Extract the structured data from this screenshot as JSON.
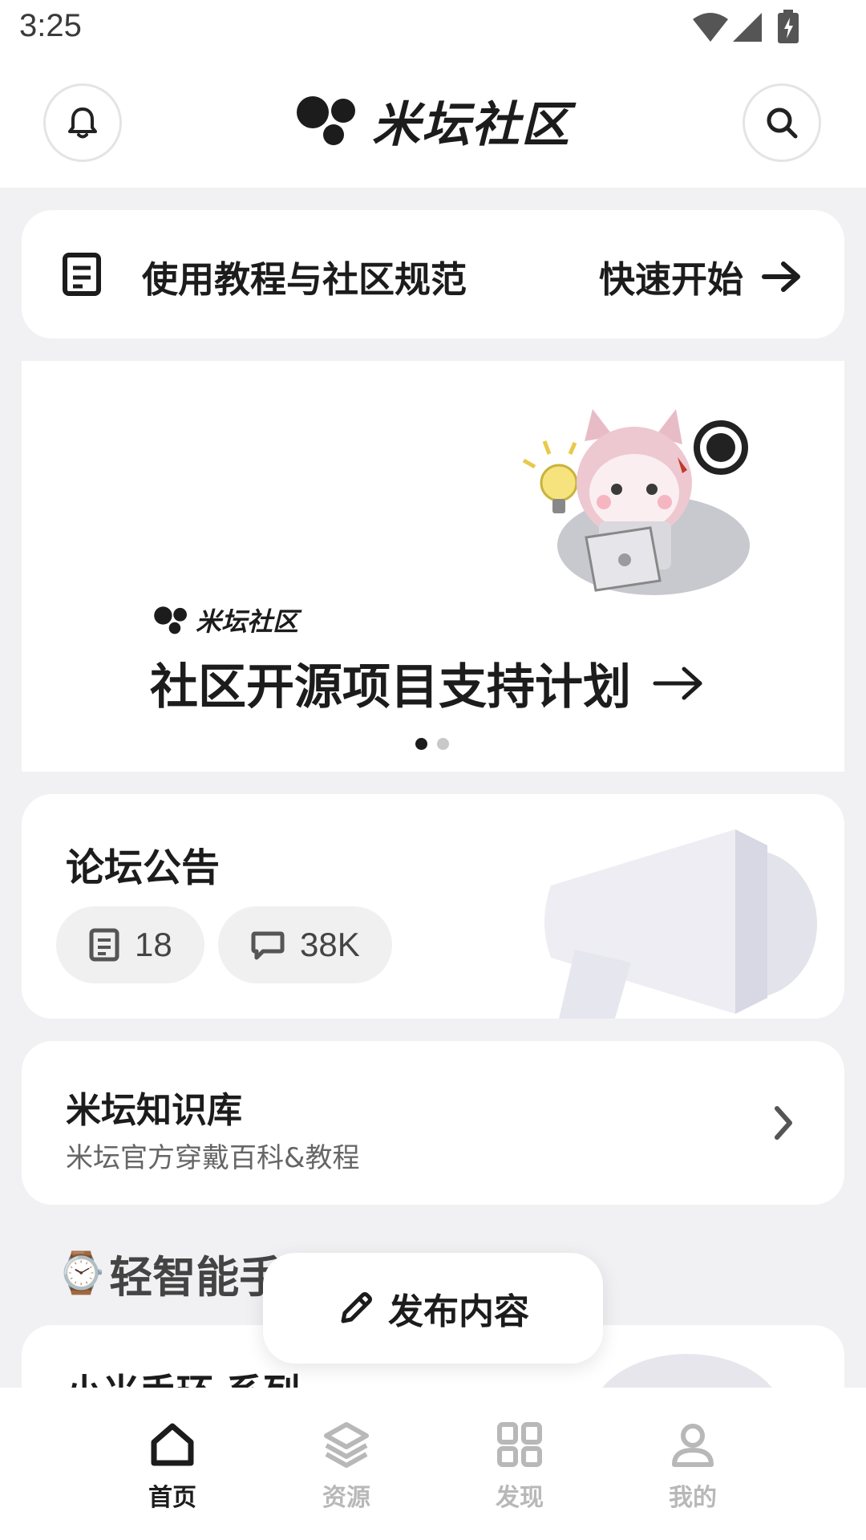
{
  "status_bar": {
    "time": "3:25"
  },
  "header": {
    "brand_text": "米坛社区",
    "notification_icon": "bell-icon",
    "search_icon": "search-icon"
  },
  "guide_card": {
    "title": "使用教程与社区规范",
    "action_label": "快速开始",
    "icon": "document-icon",
    "action_icon": "arrow-right-icon"
  },
  "banner": {
    "logo_text": "米坛社区",
    "title": "社区开源项目支持计划",
    "page_count": 2,
    "active_page": 1,
    "illustration": "cat-girl-laptop-github-illustration"
  },
  "notice_card": {
    "title": "论坛公告",
    "posts_count": "18",
    "comments_count": "38K",
    "posts_icon": "document-icon",
    "comments_icon": "comment-icon",
    "illustration": "megaphone-illustration"
  },
  "knowledge_card": {
    "title": "米坛知识库",
    "subtitle": "米坛官方穿戴百科&教程",
    "chevron_icon": "chevron-right-icon"
  },
  "section": {
    "emoji": "⌚",
    "heading": "轻智能手环 & 手表"
  },
  "partial_card": {
    "title": "小米手环 系列"
  },
  "publish_button": {
    "label": "发布内容",
    "icon": "pencil-icon"
  },
  "bottom_nav": {
    "items": [
      {
        "label": "首页",
        "icon": "home-icon",
        "active": true
      },
      {
        "label": "资源",
        "icon": "layers-icon",
        "active": false
      },
      {
        "label": "发现",
        "icon": "grid-icon",
        "active": false
      },
      {
        "label": "我的",
        "icon": "user-icon",
        "active": false
      }
    ]
  },
  "colors": {
    "active": "#1c1c1c",
    "inactive": "#b8b8b8",
    "background": "#f1f1f3"
  }
}
